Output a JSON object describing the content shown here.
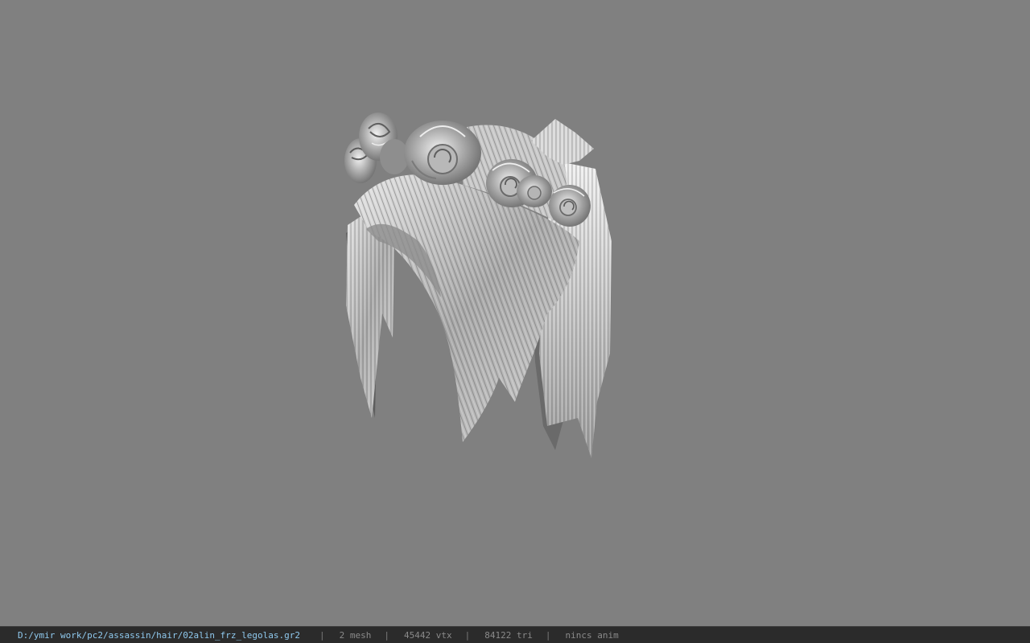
{
  "viewport": {
    "background_color": "#808080",
    "model_icon": "hair-model-icon"
  },
  "status_bar": {
    "file_path": "D:/ymir work/pc2/assassin/hair/02alin_frz_legolas.gr2",
    "separator": "|",
    "mesh_count": "2 mesh",
    "vertex_count": "45442 vtx",
    "triangle_count": "84122 tri",
    "anim_status": "nincs anim",
    "path_color": "#8fc9ee",
    "text_color": "#8a8a8a"
  }
}
